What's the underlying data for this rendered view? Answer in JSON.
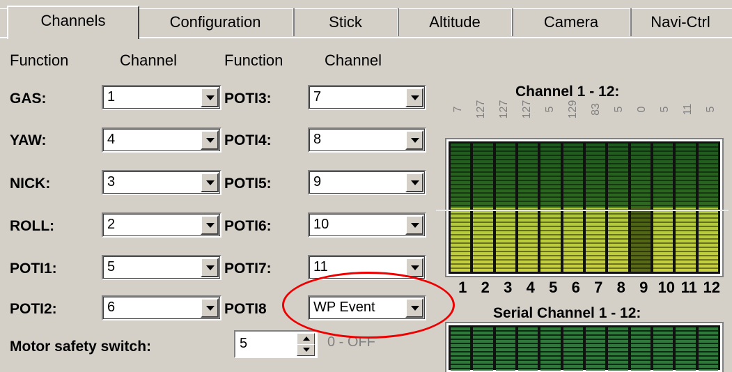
{
  "tabs": [
    "Channels",
    "Configuration",
    "Stick",
    "Altitude",
    "Camera",
    "Navi-Ctrl"
  ],
  "headers": [
    "Function",
    "Channel",
    "Function",
    "Channel"
  ],
  "left_rows": [
    {
      "label": "GAS:",
      "value": "1"
    },
    {
      "label": "YAW:",
      "value": "4"
    },
    {
      "label": "NICK:",
      "value": "3"
    },
    {
      "label": "ROLL:",
      "value": "2"
    },
    {
      "label": "POTI1:",
      "value": "5"
    },
    {
      "label": "POTI2:",
      "value": "6"
    }
  ],
  "right_rows": [
    {
      "label": "POTI3:",
      "value": "7"
    },
    {
      "label": "POTI4:",
      "value": "8"
    },
    {
      "label": "POTI5:",
      "value": "9"
    },
    {
      "label": "POTI6:",
      "value": "10"
    },
    {
      "label": "POTI7:",
      "value": "11"
    },
    {
      "label": "POTI8",
      "value": "WP Event"
    }
  ],
  "motor_safety": {
    "label": "Motor safety switch:",
    "value": "5",
    "hint": "0 - OFF"
  },
  "channel_panel": {
    "title": "Channel 1 - 12:",
    "values": [
      "7",
      "127",
      "127",
      "127",
      "5",
      "129",
      "83",
      "5",
      "0",
      "5",
      "11",
      "5"
    ],
    "numbers": [
      "1",
      "2",
      "3",
      "4",
      "5",
      "6",
      "7",
      "8",
      "9",
      "10",
      "11",
      "12"
    ]
  },
  "serial_panel": {
    "title": "Serial Channel 1 - 12:"
  },
  "colors": {
    "highlight": "#e00000",
    "bar_dark": "#1a5a1a",
    "bar_yellow": "#c8d040"
  }
}
